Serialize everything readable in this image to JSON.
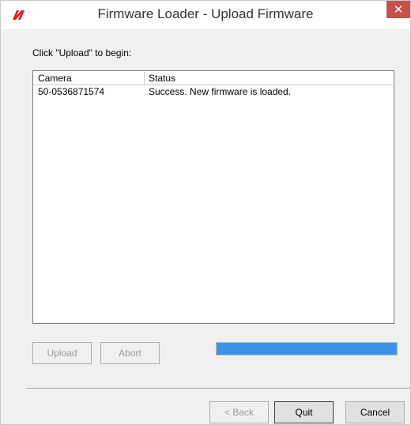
{
  "window": {
    "title": "Firmware Loader - Upload Firmware",
    "close_glyph": "✕",
    "icon": "brand-logo-icon",
    "accent_color": "#3c93e6"
  },
  "prompt": "Click \"Upload\" to begin:",
  "table": {
    "columns": [
      "Camera",
      "Status"
    ],
    "rows": [
      {
        "camera": "50-0536871574",
        "status": "Success.  New firmware is loaded."
      }
    ]
  },
  "buttons": {
    "upload": "Upload",
    "abort": "Abort",
    "back": "< Back",
    "quit": "Quit",
    "cancel": "Cancel"
  },
  "progress": {
    "percent": 100
  }
}
